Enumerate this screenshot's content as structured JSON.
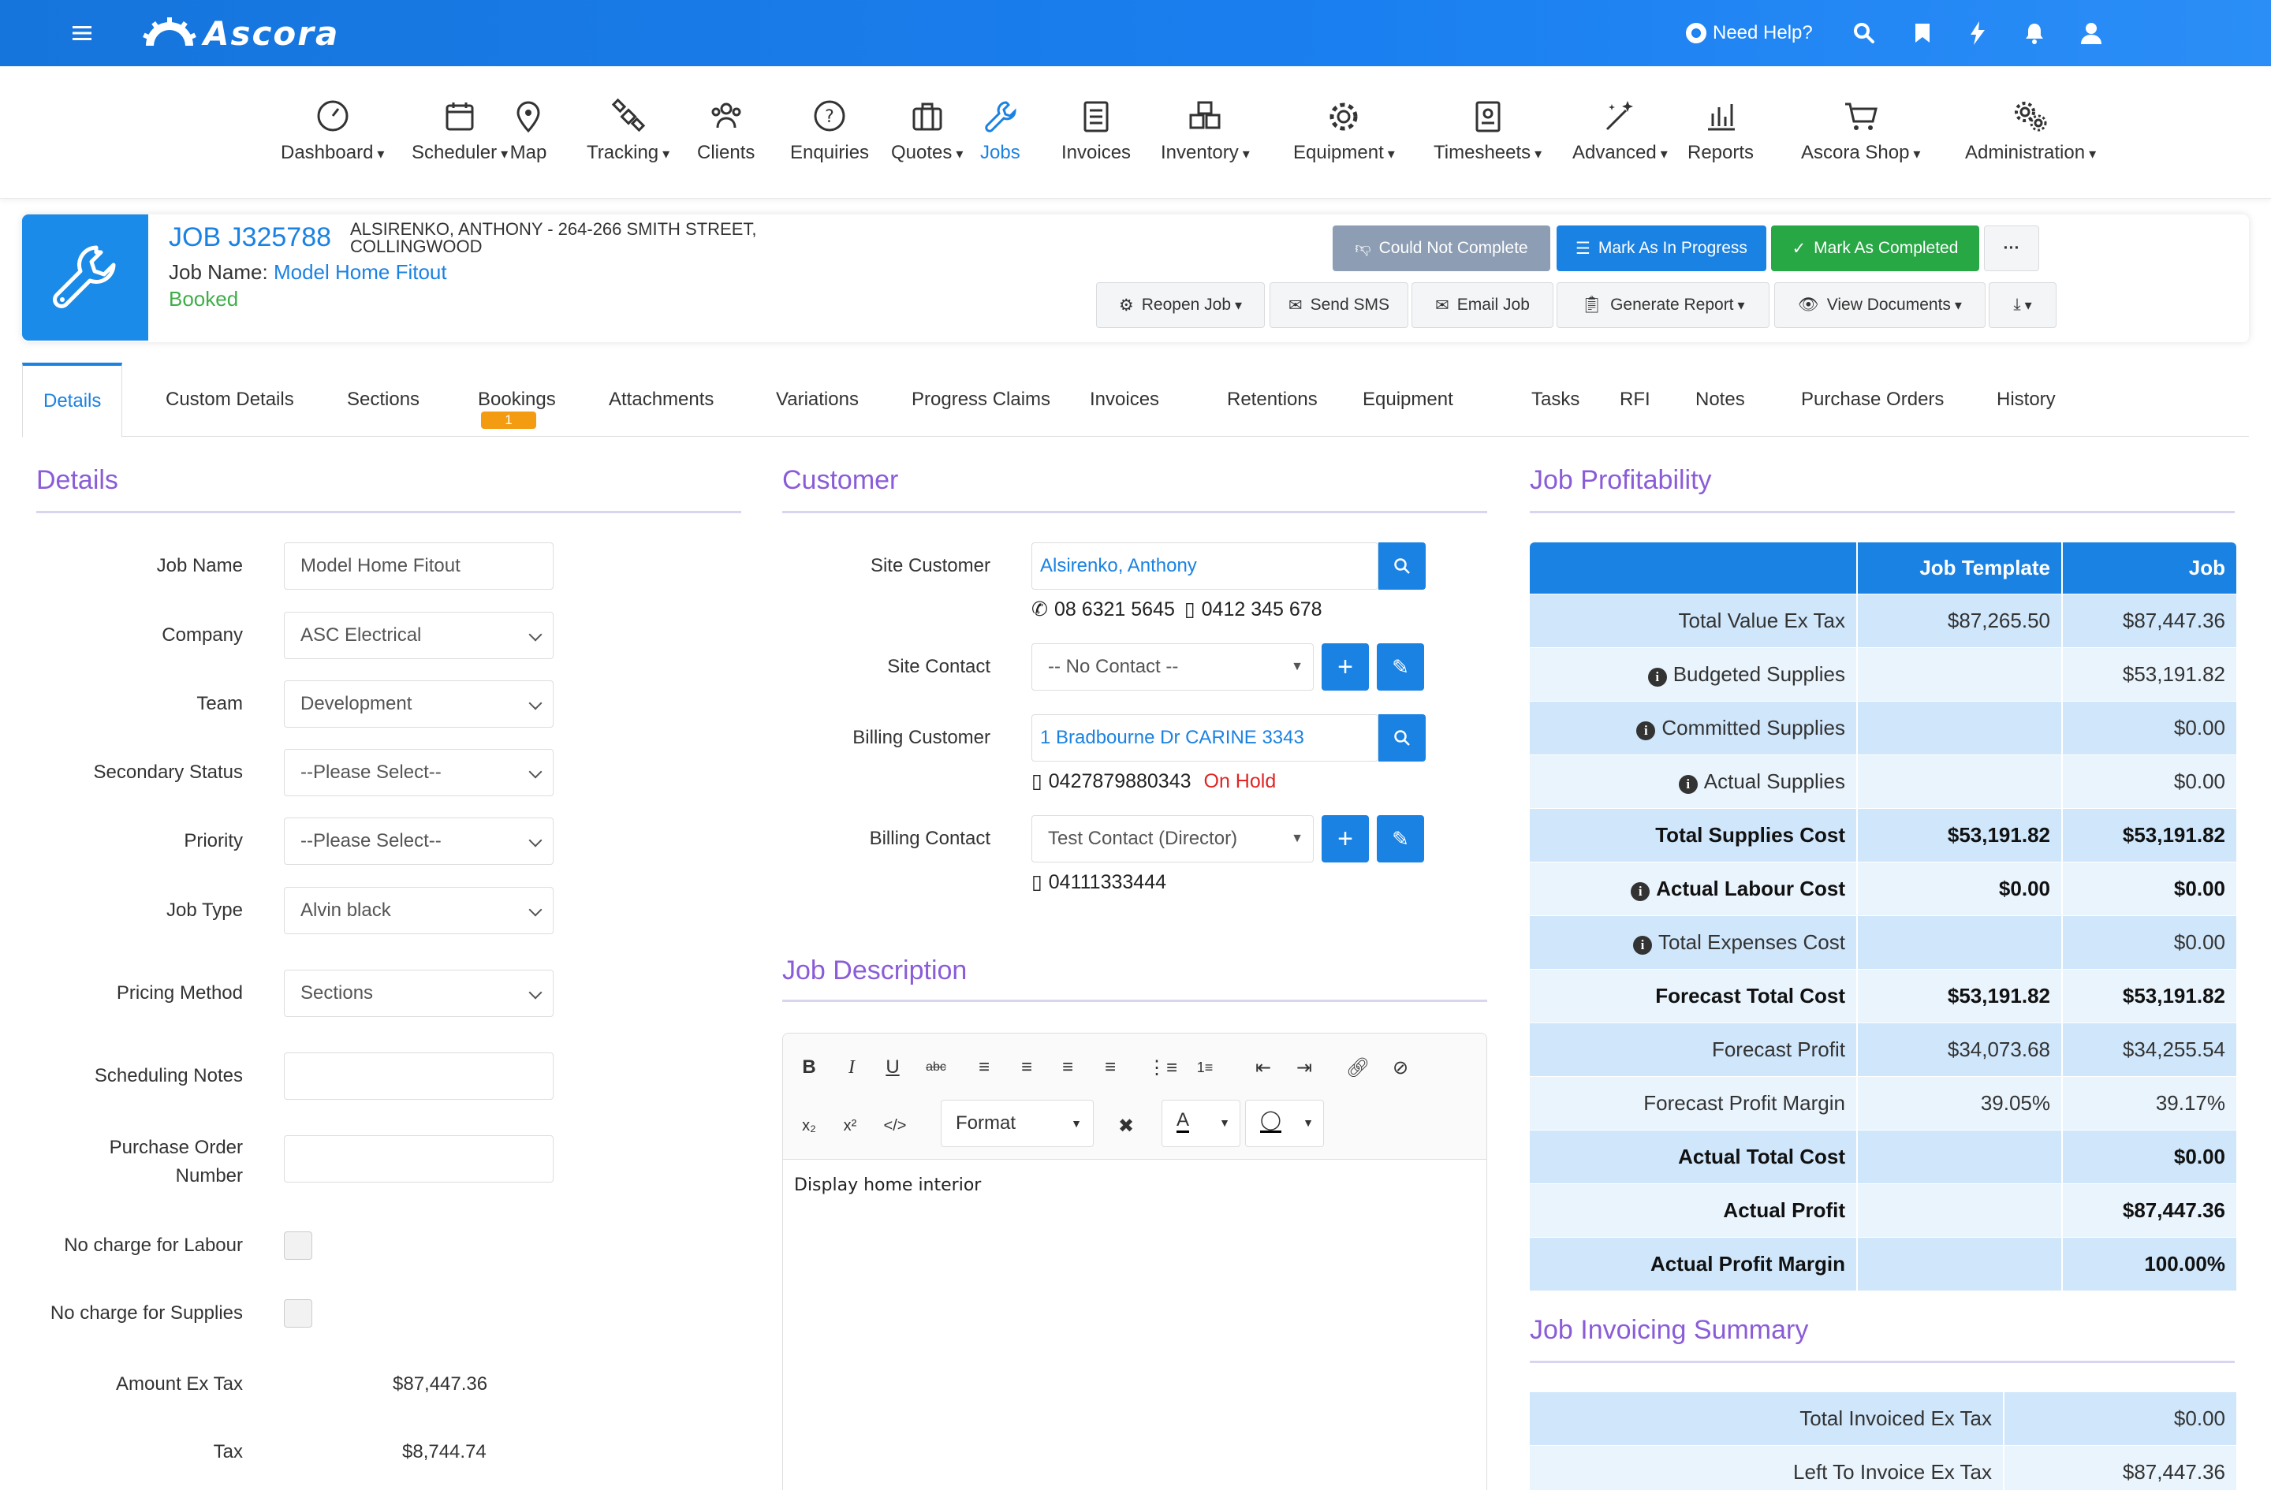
{
  "topbar": {
    "brand": "Ascora",
    "need_help": "Need Help?",
    "icons": [
      "hamburger-icon",
      "search-icon",
      "bookmark-icon",
      "bolt-icon",
      "bell-icon",
      "user-icon"
    ]
  },
  "menu": [
    {
      "label": "Dashboard",
      "icon": "dashboard-icon",
      "dropdown": true
    },
    {
      "label": "Scheduler",
      "icon": "calendar-icon",
      "dropdown": true
    },
    {
      "label": "Map",
      "icon": "map-pin-icon",
      "dropdown": false
    },
    {
      "label": "Tracking",
      "icon": "satellite-icon",
      "dropdown": true
    },
    {
      "label": "Clients",
      "icon": "clients-icon",
      "dropdown": false
    },
    {
      "label": "Enquiries",
      "icon": "question-icon",
      "dropdown": false
    },
    {
      "label": "Quotes",
      "icon": "briefcase-icon",
      "dropdown": true
    },
    {
      "label": "Jobs",
      "icon": "wrench-icon",
      "dropdown": false,
      "active": true
    },
    {
      "label": "Invoices",
      "icon": "invoice-icon",
      "dropdown": false
    },
    {
      "label": "Inventory",
      "icon": "boxes-icon",
      "dropdown": true
    },
    {
      "label": "Equipment",
      "icon": "gear-icon",
      "dropdown": true
    },
    {
      "label": "Timesheets",
      "icon": "timesheet-icon",
      "dropdown": true
    },
    {
      "label": "Advanced",
      "icon": "magic-wand-icon",
      "dropdown": true
    },
    {
      "label": "Reports",
      "icon": "bar-chart-icon",
      "dropdown": false
    },
    {
      "label": "Ascora Shop",
      "icon": "cart-icon",
      "dropdown": true
    },
    {
      "label": "Administration",
      "icon": "gears-icon",
      "dropdown": true
    }
  ],
  "job": {
    "number": "JOB J325788",
    "address_line1": "ALSIRENKO, ANTHONY - 264-266 SMITH STREET,",
    "address_line2": "COLLINGWOOD",
    "name_label": "Job Name:",
    "name_value": "Model Home Fitout",
    "status": "Booked"
  },
  "actions": {
    "could_not_complete": "Could Not Complete",
    "mark_in_progress": "Mark As In Progress",
    "mark_completed": "Mark As Completed",
    "more": "···",
    "reopen": "Reopen Job",
    "send_sms": "Send SMS",
    "email_job": "Email Job",
    "generate_report": "Generate Report",
    "view_documents": "View Documents"
  },
  "tabs": [
    "Details",
    "Custom Details",
    "Sections",
    "Bookings",
    "Attachments",
    "Variations",
    "Progress Claims",
    "Invoices",
    "Retentions",
    "Equipment",
    "Tasks",
    "RFI",
    "Notes",
    "Purchase Orders",
    "History"
  ],
  "bookings_badge": "1",
  "details": {
    "title": "Details",
    "fields": [
      {
        "label": "Job Name",
        "value": "Model Home Fitout",
        "type": "text"
      },
      {
        "label": "Company",
        "value": "ASC Electrical",
        "type": "select"
      },
      {
        "label": "Team",
        "value": "Development",
        "type": "select"
      },
      {
        "label": "Secondary Status",
        "value": "--Please Select--",
        "type": "select"
      },
      {
        "label": "Priority",
        "value": "--Please Select--",
        "type": "select"
      },
      {
        "label": "Job Type",
        "value": "Alvin black",
        "type": "select"
      },
      {
        "label": "Pricing Method",
        "value": "Sections",
        "type": "select"
      },
      {
        "label": "Scheduling Notes",
        "value": "",
        "type": "text"
      },
      {
        "label": "Purchase Order Number",
        "value": "",
        "type": "text"
      }
    ],
    "no_charge_labour": "No charge for Labour",
    "no_charge_supplies": "No charge for Supplies",
    "amount_label": "Amount Ex Tax",
    "amount_value": "$87,447.36",
    "tax_label": "Tax",
    "tax_value": "$8,744.74"
  },
  "customer": {
    "title": "Customer",
    "site_customer_label": "Site Customer",
    "site_customer_value": "Alsirenko, Anthony",
    "site_phone1": "08 6321 5645",
    "site_phone2": "0412 345 678",
    "site_contact_label": "Site Contact",
    "site_contact_value": "-- No Contact --",
    "billing_customer_label": "Billing Customer",
    "billing_customer_value": "1 Bradbourne Dr CARINE 3343",
    "billing_phone": "0427879880343",
    "billing_status": "On Hold",
    "billing_contact_label": "Billing Contact",
    "billing_contact_value": "Test Contact (Director)",
    "billing_contact_phone": "04111333444"
  },
  "job_description": {
    "title": "Job Description",
    "format_label": "Format",
    "content": "Display home interior"
  },
  "profitability": {
    "title": "Job Profitability",
    "headers": [
      "",
      "Job Template",
      "Job"
    ],
    "rows": [
      {
        "label": "Total Value Ex Tax",
        "template": "$87,265.50",
        "job": "$87,447.36",
        "bold": false,
        "info": false
      },
      {
        "label": "Budgeted Supplies",
        "template": "",
        "job": "$53,191.82",
        "bold": false,
        "info": true
      },
      {
        "label": "Committed Supplies",
        "template": "",
        "job": "$0.00",
        "bold": false,
        "info": true
      },
      {
        "label": "Actual Supplies",
        "template": "",
        "job": "$0.00",
        "bold": false,
        "info": true
      },
      {
        "label": "Total Supplies Cost",
        "template": "$53,191.82",
        "job": "$53,191.82",
        "bold": true,
        "info": false
      },
      {
        "label": "Actual Labour Cost",
        "template": "$0.00",
        "job": "$0.00",
        "bold": true,
        "info": true
      },
      {
        "label": "Total Expenses Cost",
        "template": "",
        "job": "$0.00",
        "bold": false,
        "info": true
      },
      {
        "label": "Forecast Total Cost",
        "template": "$53,191.82",
        "job": "$53,191.82",
        "bold": true,
        "info": false
      },
      {
        "label": "Forecast Profit",
        "template": "$34,073.68",
        "job": "$34,255.54",
        "bold": false,
        "info": false
      },
      {
        "label": "Forecast Profit Margin",
        "template": "39.05%",
        "job": "39.17%",
        "bold": false,
        "info": false
      },
      {
        "label": "Actual Total Cost",
        "template": "",
        "job": "$0.00",
        "bold": true,
        "info": false
      },
      {
        "label": "Actual Profit",
        "template": "",
        "job": "$87,447.36",
        "bold": true,
        "info": false
      },
      {
        "label": "Actual Profit Margin",
        "template": "",
        "job": "100.00%",
        "bold": true,
        "info": false
      }
    ]
  },
  "invoicing": {
    "title": "Job Invoicing Summary",
    "rows": [
      {
        "label": "Total Invoiced Ex Tax",
        "value": "$0.00"
      },
      {
        "label": "Left To Invoice Ex Tax",
        "value": "$87,447.36"
      }
    ]
  },
  "colors": {
    "brand_blue": "#1a82e2",
    "section_purple": "#8a5cd8",
    "success_green": "#28a745",
    "status_green": "#3fae49",
    "on_hold_red": "#e02424",
    "grey_button": "#8c9db4",
    "badge_orange": "#f39c12"
  }
}
